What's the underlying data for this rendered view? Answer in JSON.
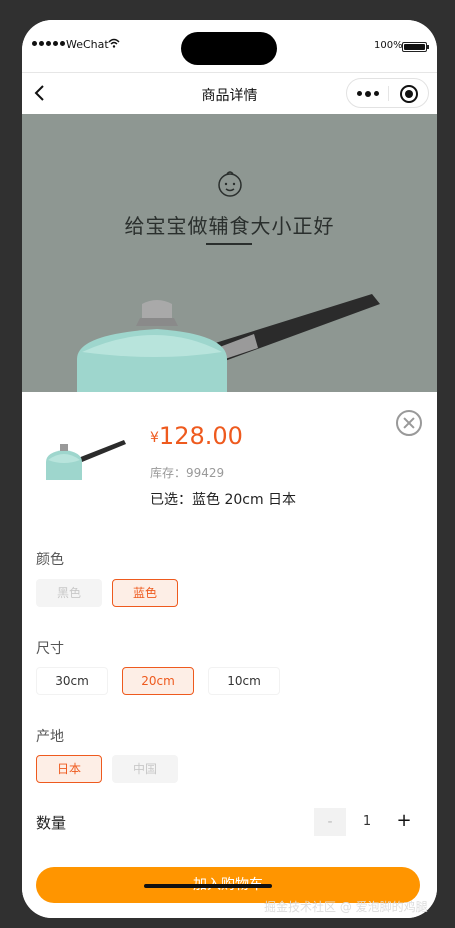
{
  "statusbar": {
    "carrier": "WeChat",
    "battery": "100%"
  },
  "navbar": {
    "title": "商品详情",
    "back_icon": "chevron-left-icon",
    "more_icon": "more-icon",
    "target_icon": "record-icon"
  },
  "hero": {
    "caption": "给宝宝做辅食大小正好",
    "icon": "baby-face-icon",
    "bg_color": "#8e9792"
  },
  "product": {
    "currency": "¥",
    "price": "128.00",
    "stock": "库存：99429",
    "selected": "已选：蓝色 20cm 日本",
    "accent_color": "#ee5a1e"
  },
  "specs": [
    {
      "label": "颜色",
      "options": [
        {
          "text": "黑色",
          "state": "disabled"
        },
        {
          "text": "蓝色",
          "state": "active"
        }
      ]
    },
    {
      "label": "尺寸",
      "options": [
        {
          "text": "30cm",
          "state": "normal"
        },
        {
          "text": "20cm",
          "state": "active"
        },
        {
          "text": "10cm",
          "state": "normal"
        }
      ]
    },
    {
      "label": "产地",
      "options": [
        {
          "text": "日本",
          "state": "active"
        },
        {
          "text": "中国",
          "state": "disabled"
        }
      ]
    }
  ],
  "quantity": {
    "label": "数量",
    "minus": "-",
    "value": "1",
    "plus": "+"
  },
  "cart_button": {
    "label": "加入购物车",
    "color": "#ff9500"
  },
  "watermark": "掘金技术社区 @ 爱泡脚的鸡腿"
}
